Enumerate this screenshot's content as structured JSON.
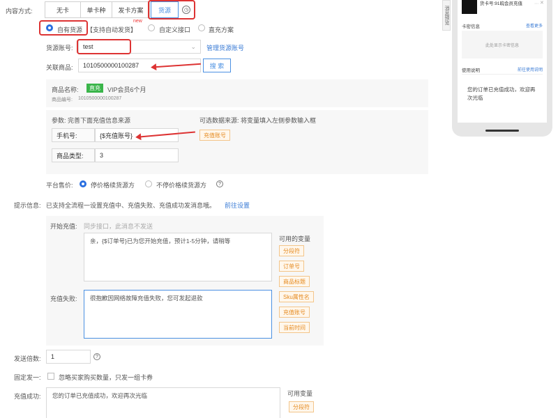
{
  "content_method": {
    "label": "内容方式:",
    "tabs": [
      "无卡",
      "单卡种",
      "发卡方案",
      "货源"
    ]
  },
  "source_type": {
    "options": [
      "自有货源",
      "【支持自动发货】",
      "自定义接口",
      "直充方案"
    ],
    "new_badge": "new"
  },
  "source_account": {
    "label": "货源账号:",
    "value": "test",
    "manage_link": "管理货源账号"
  },
  "linked_product": {
    "label": "关联商品:",
    "value": "1010500000100287",
    "search_button": "搜 索"
  },
  "product_info": {
    "name_label": "商品名称:",
    "badge": "直充",
    "name_value": "VIP会员6个月",
    "code_label": "商品编号:",
    "code_value": "1010500000100287"
  },
  "params": {
    "title": "参数: 完善下面充值信息来源",
    "hint": "可选数据来源: 将变量填入左侧参数输入框",
    "phone_label": "手机号:",
    "phone_value": "{$充值账号}",
    "recharge_tag": "充值账号",
    "type_label": "商品类型:",
    "type_value": "3"
  },
  "platform_price": {
    "label": "平台售价:",
    "options": [
      "停价格续货源方",
      "不停价格续货源方"
    ]
  },
  "notice": {
    "label": "提示信息:",
    "text": "已支持全流程一设置充值中、充值失败、充值成功发消息哦。",
    "link": "前往设置"
  },
  "notice_panel": {
    "start_label": "开始充值:",
    "start_hint": "同步接口，此消息不发送",
    "processing_text": "亲，{$订单号}已为您开始充值，预计1-5分钟，请稍等",
    "fail_label": "充值失败:",
    "fail_text": "很抱歉因网络故障充值失败，您可发起退款",
    "vars_title": "可用的变量",
    "vars": [
      "分段符",
      "订单号",
      "商品标题",
      "Sku属性名",
      "充值账号",
      "当前时间"
    ]
  },
  "send_multiple": {
    "label": "发送倍数:",
    "value": "1"
  },
  "fixed_send": {
    "label": "固定发一:",
    "text": "忽略买家购买数量，只发一组卡券"
  },
  "success": {
    "label": "充值成功:",
    "text": "您的订单已充值成功，欢迎再次光临",
    "vars_title": "可用变量",
    "var": "分段符"
  },
  "side_tab": {
    "text": "消息预览"
  },
  "phone_preview": {
    "header_text": "货卡号:91皖会员充值",
    "section1": "卡密信息",
    "section1_link": "查看更多",
    "empty_text": "此处显示卡密信息",
    "section2": "使用说明",
    "section2_link": "前往使用说明",
    "message": "您的订单已充值成功，欢迎再次光临"
  }
}
